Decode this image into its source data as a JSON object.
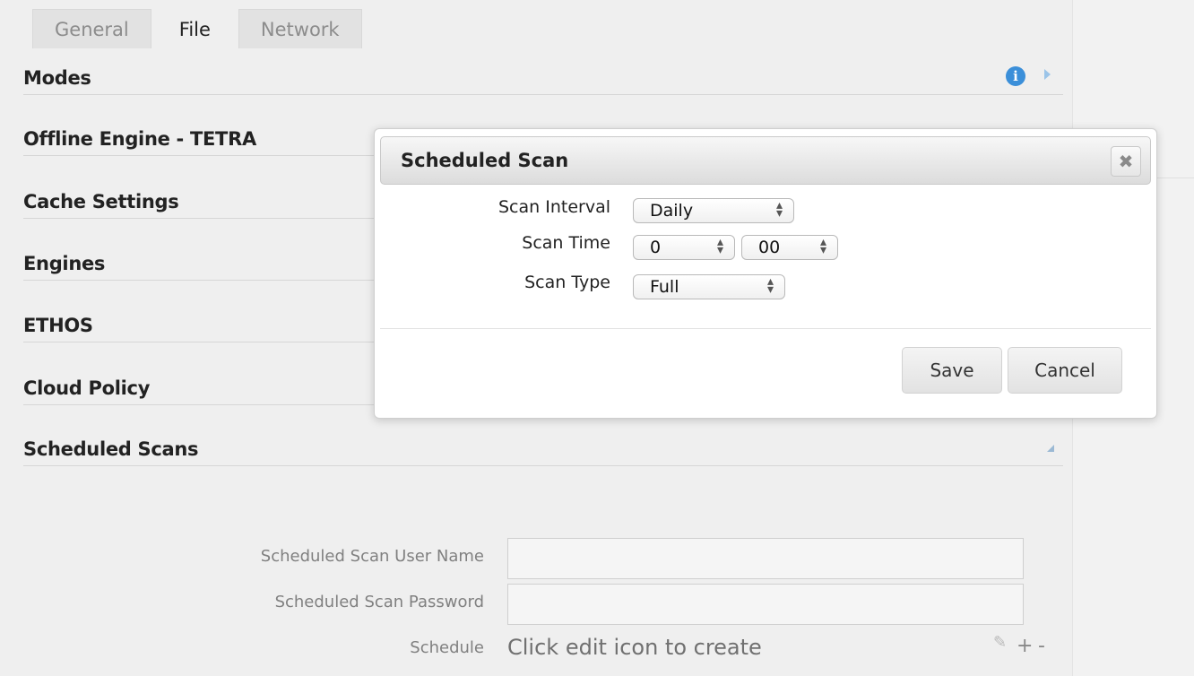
{
  "tabs": [
    {
      "label": "General",
      "active": false
    },
    {
      "label": "File",
      "active": true
    },
    {
      "label": "Network",
      "active": false
    }
  ],
  "sections": [
    {
      "title": "Modes"
    },
    {
      "title": "Offline Engine - TETRA"
    },
    {
      "title": "Cache Settings"
    },
    {
      "title": "Engines"
    },
    {
      "title": "ETHOS"
    },
    {
      "title": "Cloud Policy"
    },
    {
      "title": "Scheduled Scans"
    }
  ],
  "icons": {
    "info": "info-icon",
    "info_glyph": "i",
    "expand": "caret-right-icon",
    "collapse": "caret-collapse-icon",
    "pencil": "pencil-icon",
    "pencil_glyph": "✎"
  },
  "scheduled_form": {
    "user_name_label": "Scheduled Scan User Name",
    "user_name_value": "",
    "password_label": "Scheduled Scan Password",
    "password_value": "",
    "schedule_label": "Schedule",
    "schedule_value": "Click edit icon to create",
    "plus": "+",
    "minus": "-"
  },
  "modal": {
    "title": "Scheduled Scan",
    "close_glyph": "✖",
    "interval_label": "Scan Interval",
    "interval_value": "Daily",
    "time_label": "Scan Time",
    "time_hour": "0",
    "time_minute": "00",
    "type_label": "Scan Type",
    "type_value": "Full",
    "save": "Save",
    "cancel": "Cancel"
  },
  "colors": {
    "accent": "#3b8fd9",
    "background": "#efefef"
  }
}
